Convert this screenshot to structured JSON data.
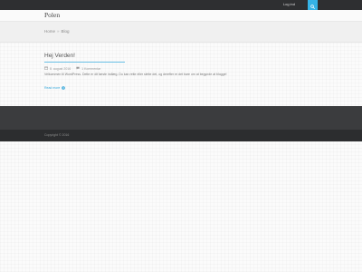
{
  "topbar": {
    "login_label": "Log ind",
    "search_icon": "search-icon",
    "accent_color": "#35b3e6"
  },
  "header": {
    "site_title": "Polen"
  },
  "breadcrumb": {
    "home": "Home",
    "separator": "»",
    "current": "Blog"
  },
  "post": {
    "title": "Hej Verden!",
    "date": "8. august 2016",
    "comments": "1 Kommentar",
    "excerpt": "Velkommen til WordPress. Dette er dit første indlæg. Du kan rette eller slette det, og derefter er det bare om at begynde at blogge!",
    "read_more": "Read more"
  },
  "footer": {
    "copyright": "Copyright © 2016"
  }
}
